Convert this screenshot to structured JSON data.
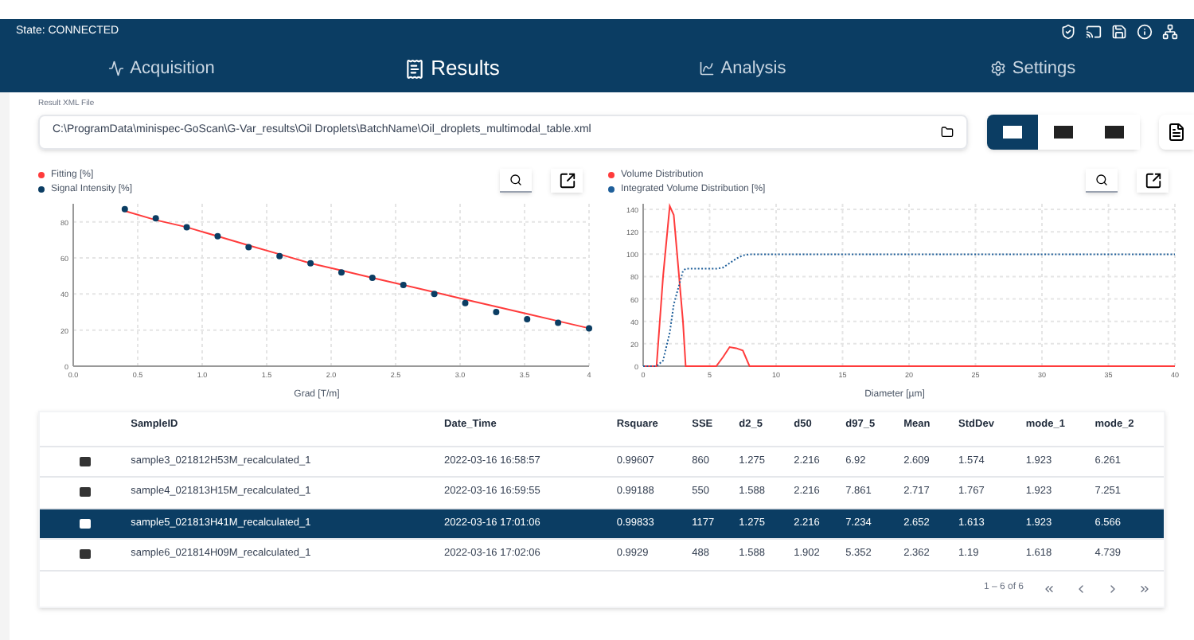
{
  "status": {
    "label": "State: CONNECTED"
  },
  "tabs": [
    {
      "label": "Acquisition",
      "selected": false
    },
    {
      "label": "Results",
      "selected": true
    },
    {
      "label": "Analysis",
      "selected": false
    },
    {
      "label": "Settings",
      "selected": false
    }
  ],
  "file": {
    "label": "Result XML File",
    "value": "C:\\ProgramData\\minispec-GoScan\\G-Var_results\\Oil Droplets\\BatchName\\Oil_droplets_multimodal_table.xml"
  },
  "view_buttons": [
    {
      "selected": true
    },
    {
      "selected": false
    },
    {
      "selected": false
    }
  ],
  "charts": [
    {
      "chart_data": {
        "type": "line",
        "xlabel": "Grad [T/m]",
        "xlim": [
          0,
          4
        ],
        "ylim": [
          0,
          90
        ],
        "xticks": [
          {
            "value": 0,
            "label": "0.0"
          },
          {
            "value": 0.5,
            "label": "0.5"
          },
          {
            "value": 1,
            "label": "1.0"
          },
          {
            "value": 1.5,
            "label": "1.5"
          },
          {
            "value": 2,
            "label": "2.0"
          },
          {
            "value": 2.5,
            "label": "2.5"
          },
          {
            "value": 3,
            "label": "3.0"
          },
          {
            "value": 3.5,
            "label": "3.5"
          },
          {
            "value": 4,
            "label": "4"
          }
        ],
        "grid": true,
        "yticks": [
          0,
          20,
          40,
          60,
          80
        ],
        "x": [
          0.4,
          0.64,
          0.88,
          1.12,
          1.36,
          1.6,
          1.84,
          2.08,
          2.32,
          2.56,
          2.8,
          3.04,
          3.28,
          3.52,
          3.76,
          4.0
        ],
        "series": [
          {
            "name": "Fitting [%]",
            "color": "#ff3b3b",
            "line_style": "solid",
            "marker": false,
            "values": [
              86,
              81,
              77,
              72,
              67,
              62,
              57,
              53,
              49,
              45,
              41,
              37,
              33,
              29,
              25,
              21
            ]
          },
          {
            "name": "Signal Intensity [%]",
            "color": "#0b3d63",
            "type": "scatter",
            "marker": true,
            "values": [
              87,
              82,
              77,
              72,
              66,
              61,
              57,
              52,
              49,
              45,
              40,
              35,
              30,
              26,
              24,
              21
            ]
          }
        ]
      }
    },
    {
      "chart_data": {
        "type": "line",
        "xlabel": "Diameter [µm]",
        "xlim": [
          0,
          40
        ],
        "ylim": [
          0,
          145
        ],
        "grid": true,
        "xticks": [
          0,
          5,
          10,
          15,
          20,
          25,
          30,
          35,
          40
        ],
        "yticks": [
          0,
          20,
          40,
          60,
          80,
          100,
          120,
          140
        ],
        "x": [
          0,
          1,
          1.5,
          2,
          2.3,
          3,
          3.2,
          4,
          5,
          5.5,
          6,
          6.5,
          7,
          7.5,
          8,
          10,
          40
        ],
        "series": [
          {
            "name": "Volume Distribution",
            "color": "#ff3b3b",
            "line_style": "solid",
            "marker": false,
            "values": [
              0,
              0,
              80,
              143,
              135,
              40,
              0,
              0,
              0,
              0,
              8,
              17,
              16,
              14,
              0,
              0,
              0
            ]
          },
          {
            "name": "Integrated Volume Distribution [%]",
            "color": "#1f5f9a",
            "line_style": "dotted",
            "marker": false,
            "values": [
              0,
              0,
              5,
              30,
              55,
              85,
              87,
              87,
              87,
              87,
              88,
              92,
              96,
              99,
              100,
              100,
              100
            ]
          }
        ]
      }
    }
  ],
  "table": {
    "columns": [
      "SampleID",
      "Date_Time",
      "Rsquare",
      "SSE",
      "d2_5",
      "d50",
      "d97_5",
      "Mean",
      "StdDev",
      "mode_1",
      "mode_2"
    ],
    "rows": [
      {
        "selected": false,
        "cells": [
          "sample3_021812H53M_recalculated_1",
          "2022-03-16 16:58:57",
          "0.99607",
          "860",
          "1.275",
          "2.216",
          "6.92",
          "2.609",
          "1.574",
          "1.923",
          "6.261"
        ]
      },
      {
        "selected": false,
        "cells": [
          "sample4_021813H15M_recalculated_1",
          "2022-03-16 16:59:55",
          "0.99188",
          "550",
          "1.588",
          "2.216",
          "7.861",
          "2.717",
          "1.767",
          "1.923",
          "7.251"
        ]
      },
      {
        "selected": true,
        "cells": [
          "sample5_021813H41M_recalculated_1",
          "2022-03-16 17:01:06",
          "0.99833",
          "1177",
          "1.275",
          "2.216",
          "7.234",
          "2.652",
          "1.613",
          "1.923",
          "6.566"
        ]
      },
      {
        "selected": false,
        "cells": [
          "sample6_021814H09M_recalculated_1",
          "2022-03-16 17:02:06",
          "0.9929",
          "488",
          "1.588",
          "1.902",
          "5.352",
          "2.362",
          "1.19",
          "1.618",
          "4.739"
        ]
      }
    ]
  },
  "pagination": {
    "range": "1 – 6 of 6"
  }
}
